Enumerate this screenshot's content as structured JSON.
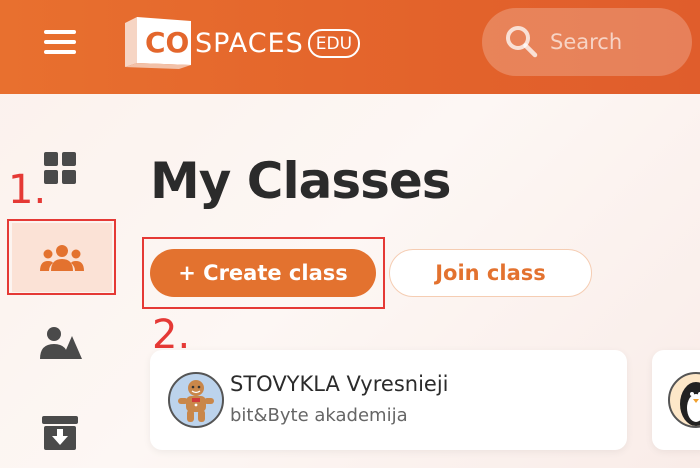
{
  "header": {
    "logo": {
      "co": "CO",
      "spaces": "SPACES",
      "edu": "EDU"
    },
    "search": {
      "placeholder": "Search"
    }
  },
  "sidebar": {
    "items": [
      {
        "name": "dashboard",
        "icon": "grid-icon"
      },
      {
        "name": "classes",
        "icon": "group-icon",
        "active": true
      },
      {
        "name": "people",
        "icon": "people-icon"
      },
      {
        "name": "archive",
        "icon": "archive-icon"
      }
    ]
  },
  "annotations": {
    "step1": "1.",
    "step2": "2."
  },
  "main": {
    "title": "My Classes",
    "create_label": "+ Create class",
    "join_label": "Join class",
    "classes": [
      {
        "title": "STOVYKLA Vyresnieji",
        "subtitle": "bit&Byte akademija",
        "avatar": "gingerbread-avatar"
      },
      {
        "title": "",
        "subtitle": "",
        "avatar": "penguin-avatar"
      }
    ]
  },
  "colors": {
    "accent": "#e3722f",
    "header": "#e3632b",
    "highlight": "#e53935",
    "active_bg": "#fbe2d6"
  }
}
